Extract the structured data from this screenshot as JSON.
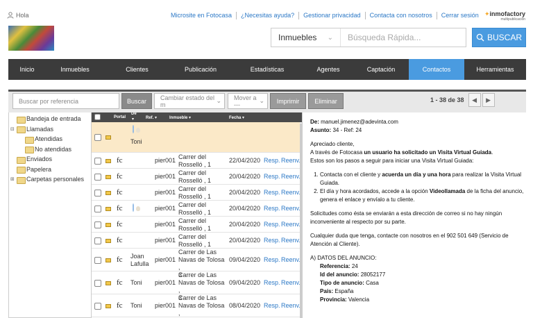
{
  "header": {
    "greeting": "Hola",
    "links": [
      "Microsite en Fotocasa",
      "¿Necesitas ayuda?",
      "Gestionar privacidad",
      "Contacta con nosotros",
      "Cerrar sesión"
    ],
    "logo_main": "inmofactory",
    "logo_sub": "multipublicación"
  },
  "search": {
    "category": "Inmuebles",
    "placeholder": "Búsqueda Rápida...",
    "button": "BUSCAR"
  },
  "nav": {
    "items": [
      "Inicio",
      "Inmuebles",
      "Clientes",
      "Publicación",
      "Estadísticas",
      "Agentes",
      "Captación",
      "Contactos",
      "Herramientas"
    ],
    "active": "Contactos"
  },
  "toolbar": {
    "ref_placeholder": "Buscar por referencia",
    "search_btn": "Buscar",
    "state_select": "Cambiar estado del m",
    "move_select": "Mover a ---",
    "print_btn": "Imprimir",
    "delete_btn": "Eliminar",
    "count": "1 - 38 de 38"
  },
  "folders": [
    {
      "label": "Bandeja de entrada",
      "level": 0,
      "toggle": ""
    },
    {
      "label": "Llamadas",
      "level": 0,
      "toggle": "⊟"
    },
    {
      "label": "Atendidas",
      "level": 1,
      "toggle": ""
    },
    {
      "label": "No atendidas",
      "level": 1,
      "toggle": ""
    },
    {
      "label": "Enviados",
      "level": 0,
      "toggle": ""
    },
    {
      "label": "Papelera",
      "level": 0,
      "toggle": ""
    },
    {
      "label": "Carpetas personales",
      "level": 0,
      "toggle": "⊞"
    }
  ],
  "list": {
    "headers": {
      "portal": "Portal",
      "de": "De",
      "ref": "Ref.",
      "inmueble": "Inmueble",
      "fecha": "Fecha"
    },
    "rows": [
      {
        "portal": "",
        "de": "Toni",
        "de_avatar": true,
        "ref": "",
        "inmueble": [
          "",
          "",
          ""
        ],
        "fecha": "",
        "resp": "",
        "reenv": "",
        "selected": true
      },
      {
        "portal": "fc",
        "de": "",
        "de_avatar": false,
        "ref": "pier001",
        "inmueble": [
          "Carrer del",
          "Rosselló , 1"
        ],
        "fecha": "22/04/2020",
        "resp": "Resp.",
        "reenv": "Reenv.",
        "selected": false
      },
      {
        "portal": "fc",
        "de": "",
        "de_avatar": false,
        "ref": "pier001",
        "inmueble": [
          "Carrer del",
          "Rosselló , 1"
        ],
        "fecha": "20/04/2020",
        "resp": "Resp.",
        "reenv": "Reenv.",
        "selected": false
      },
      {
        "portal": "fc",
        "de": "",
        "de_avatar": false,
        "ref": "pier001",
        "inmueble": [
          "Carrer del",
          "Rosselló , 1"
        ],
        "fecha": "20/04/2020",
        "resp": "Resp.",
        "reenv": "Reenv.",
        "selected": false
      },
      {
        "portal": "fc",
        "de": "",
        "de_avatar": true,
        "ref": "pier001",
        "inmueble": [
          "Carrer del",
          "Rosselló , 1"
        ],
        "fecha": "20/04/2020",
        "resp": "Resp.",
        "reenv": "Reenv.",
        "selected": false
      },
      {
        "portal": "fc",
        "de": "",
        "de_avatar": false,
        "ref": "pier001",
        "inmueble": [
          "Carrer del",
          "Rosselló , 1"
        ],
        "fecha": "20/04/2020",
        "resp": "Resp.",
        "reenv": "Reenv.",
        "selected": false
      },
      {
        "portal": "fc",
        "de": "",
        "de_avatar": false,
        "ref": "pier001",
        "inmueble": [
          "Carrer del",
          "Rosselló , 1"
        ],
        "fecha": "20/04/2020",
        "resp": "Resp.",
        "reenv": "Reenv.",
        "selected": false
      },
      {
        "portal": "fc",
        "de": "Joan Lafulla",
        "de_avatar": false,
        "ref": "pier001",
        "inmueble": [
          "Carrer de Las",
          "Navas de Tolosa ,",
          "3"
        ],
        "fecha": "09/04/2020",
        "resp": "Resp.",
        "reenv": "Reenv.",
        "selected": false
      },
      {
        "portal": "fc",
        "de": "Toni",
        "de_avatar": false,
        "ref": "pier001",
        "inmueble": [
          "Carrer de Las",
          "Navas de Tolosa ,",
          "3"
        ],
        "fecha": "09/04/2020",
        "resp": "Resp.",
        "reenv": "Reenv.",
        "selected": false
      },
      {
        "portal": "fc",
        "de": "Toni",
        "de_avatar": false,
        "ref": "pier001",
        "inmueble": [
          "Carrer de Las",
          "Navas de Tolosa ,",
          "3"
        ],
        "fecha": "08/04/2020",
        "resp": "Resp.",
        "reenv": "Reenv.",
        "selected": false
      }
    ]
  },
  "preview": {
    "de_label": "De:",
    "de_value": "manuel.jimenez@adevinta.com",
    "asunto_label": "Asunto:",
    "asunto_value": "34 - Ref: 24",
    "greeting": "Apreciado cliente,",
    "p1_a": "A través de Fotocasa ",
    "p1_b": "un usuario ha solicitado un Visita Virtual Guiada",
    "p1_c": ".",
    "p1_d": "Estos son los pasos a seguir para iniciar una Visita Virtual Guiada:",
    "step1_a": "Contacta con el cliente y ",
    "step1_b": "acuerda un día y una hora",
    "step1_c": " para realizar la Visita Virtual Guiada.",
    "step2_a": "El día y hora acordados, accede a la opción ",
    "step2_b": "Videollamada",
    "step2_c": " de la ficha del anuncio, genera el enlace y envíalo a tu cliente.",
    "p2": "Solicitudes como ésta se enviarán a esta dirección de correo si no hay ningún inconveniente al respecto por su parte.",
    "p3": "Cualquier duda que tenga, contacte con nosotros en el 902 501 649 (Servicio de Atención al Cliente).",
    "section": "A) DATOS DEL ANUNCIO:",
    "fields": [
      {
        "label": "Referencia:",
        "value": "24"
      },
      {
        "label": "Id del anuncio:",
        "value": "28052177"
      },
      {
        "label": "Tipo de anuncio:",
        "value": "Casa"
      },
      {
        "label": "País:",
        "value": "España"
      },
      {
        "label": "Provincia:",
        "value": "Valencia"
      }
    ]
  }
}
